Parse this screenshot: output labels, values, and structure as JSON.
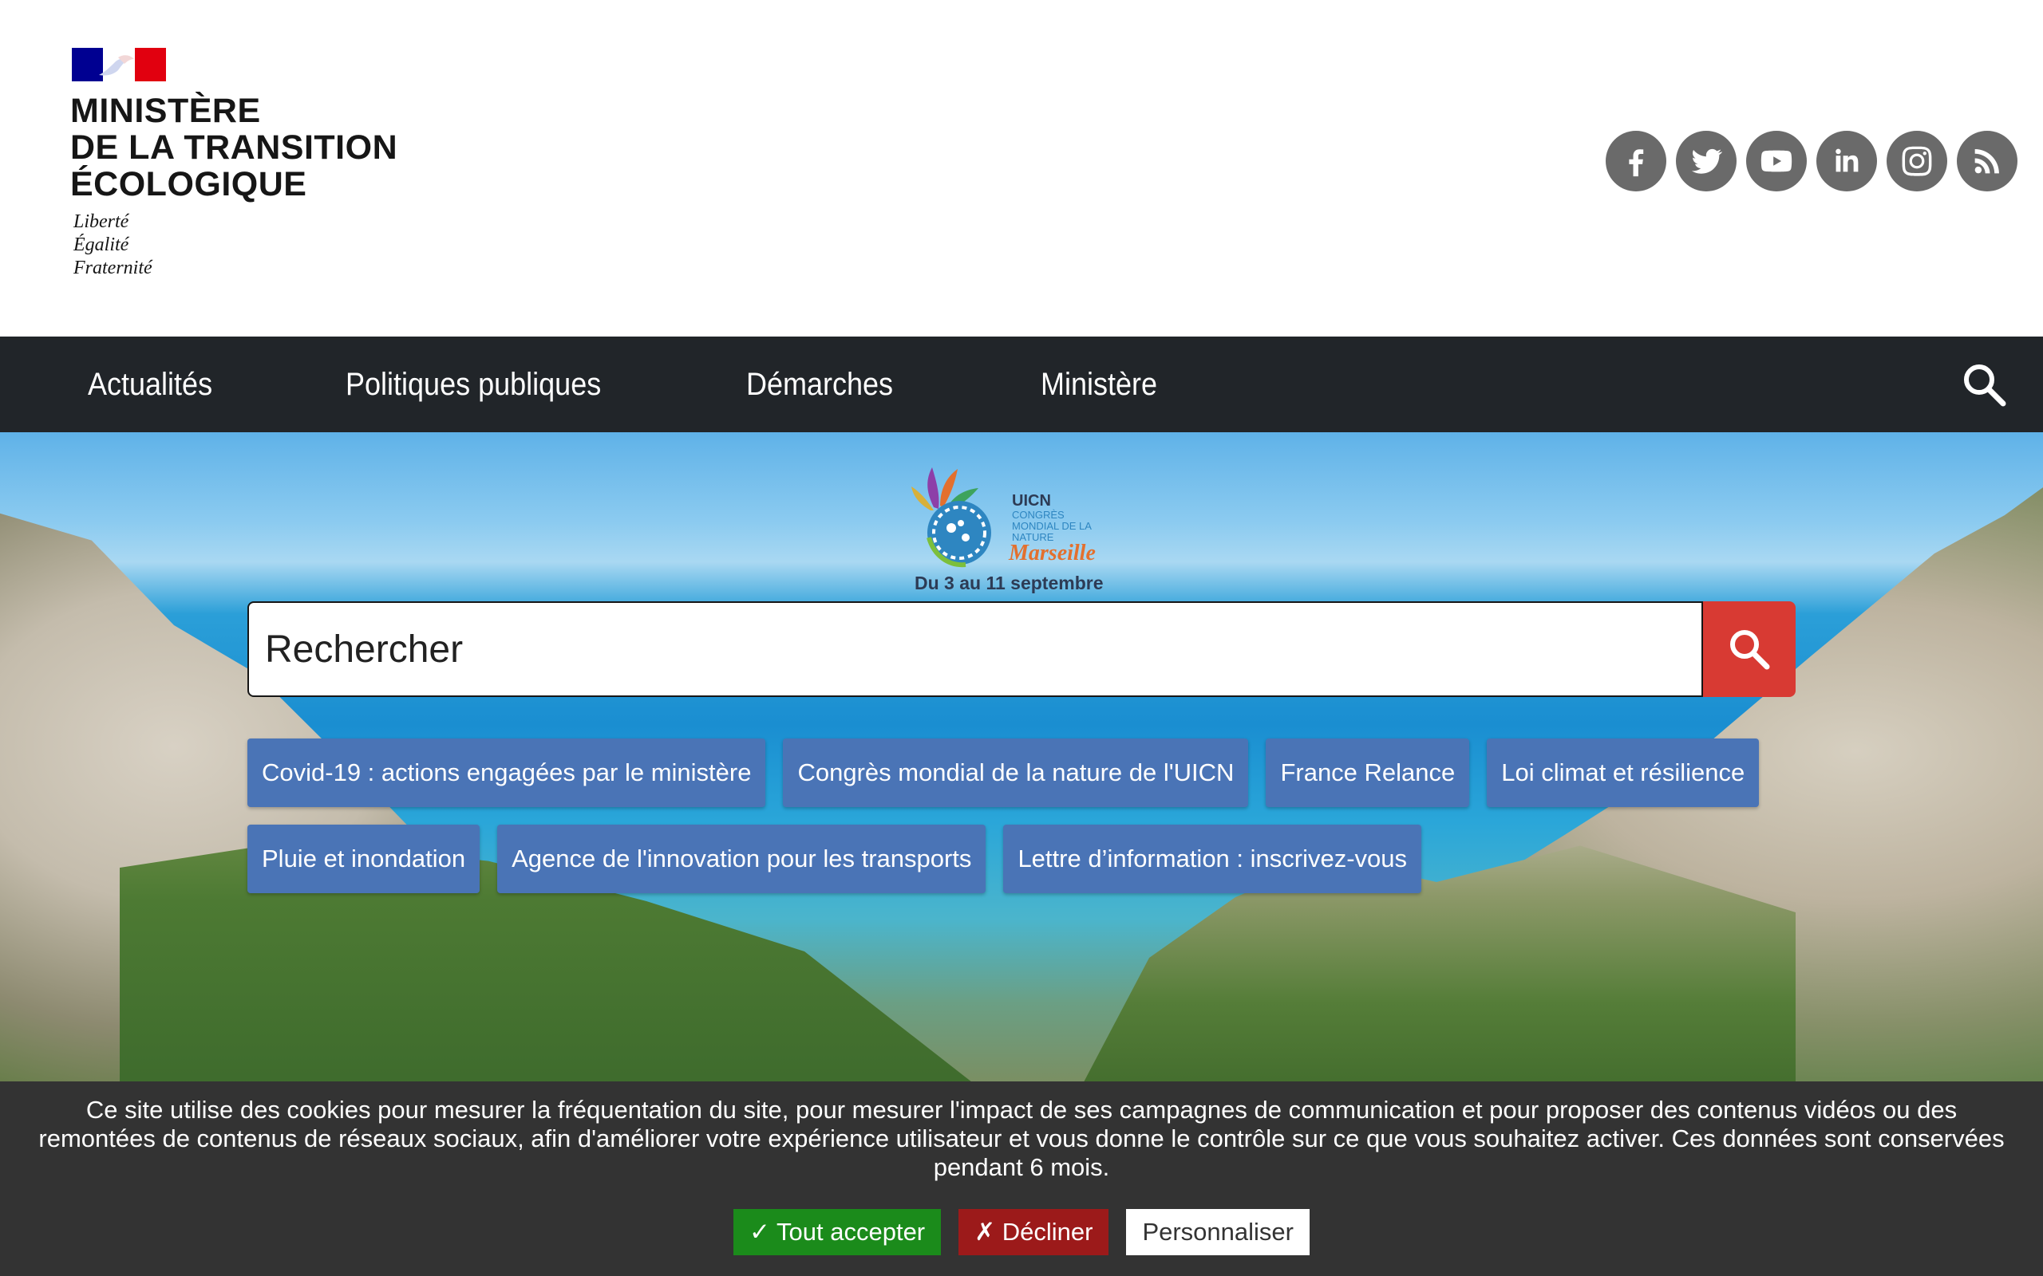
{
  "header": {
    "ministry_lines": [
      "MINISTÈRE",
      "DE LA TRANSITION",
      "ÉCOLOGIQUE"
    ],
    "motto": [
      "Liberté",
      "Égalité",
      "Fraternité"
    ],
    "social": [
      {
        "name": "facebook-icon"
      },
      {
        "name": "twitter-icon"
      },
      {
        "name": "youtube-icon"
      },
      {
        "name": "linkedin-icon"
      },
      {
        "name": "instagram-icon"
      },
      {
        "name": "rss-icon"
      }
    ]
  },
  "nav": {
    "items": [
      "Actualités",
      "Politiques publiques",
      "Démarches",
      "Ministère"
    ],
    "search_icon": "search-icon"
  },
  "hero": {
    "event": {
      "lines": [
        "UICN",
        "CONGRÈS",
        "MONDIAL DE LA",
        "NATURE",
        "Marseille"
      ],
      "dates": "Du 3 au 11 septembre"
    },
    "search": {
      "placeholder": "Rechercher",
      "button_icon": "search-icon"
    },
    "tags": [
      [
        "Covid-19 : actions engagées par le ministère",
        "Congrès mondial de la nature de l'UICN",
        "France Relance",
        "Loi climat et résilience"
      ],
      [
        "Pluie et inondation",
        "Agence de l'innovation pour les transports",
        "Lettre d’information : inscrivez-vous"
      ]
    ]
  },
  "cookie": {
    "text": "Ce site utilise des cookies pour mesurer la fréquentation du site, pour mesurer l'impact de ses campagnes de communication et pour proposer des contenus vidéos ou des remontées de contenus de réseaux sociaux, afin d'améliorer votre expérience utilisateur et vous donne le contrôle sur ce que vous souhaitez activer. Ces données sont conservées pendant 6 mois.",
    "accept": "✓ Tout accepter",
    "decline": "✗ Décliner",
    "customize": "Personnaliser"
  },
  "colors": {
    "nav_bg": "#212529",
    "search_button": "#d83a33",
    "tag_bg": "#4a74b6",
    "cookie_bg": "#333333",
    "accept_bg": "#1b8b1b",
    "decline_bg": "#9c1a1a"
  }
}
